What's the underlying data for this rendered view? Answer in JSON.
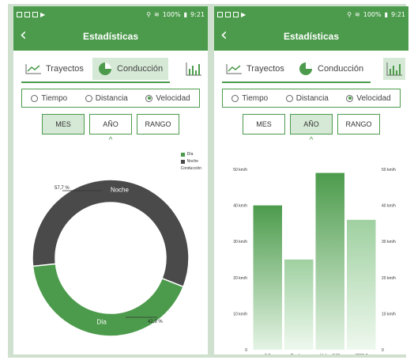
{
  "status": {
    "time": "9:21",
    "battery": "100%"
  },
  "left": {
    "title": "Estadísticas",
    "tabs": {
      "trayectos": "Trayectos",
      "conduccion": "Conducción"
    },
    "radios": [
      {
        "label": "Tiempo",
        "selected": false
      },
      {
        "label": "Distancia",
        "selected": false
      },
      {
        "label": "Velocidad",
        "selected": true
      }
    ],
    "ranges": [
      {
        "label": "MES",
        "active": true
      },
      {
        "label": "AÑO",
        "active": false
      },
      {
        "label": "RANGO",
        "active": false
      }
    ],
    "legend": {
      "dia": "Día",
      "noche": "Noche",
      "caption": "Conducción"
    },
    "chart_data": {
      "type": "pie",
      "donut": true,
      "slices": [
        {
          "label": "Noche",
          "value": 57.7,
          "value_label": "57,7 %",
          "color": "#4a4a4a"
        },
        {
          "label": "Día",
          "value": 42.3,
          "value_label": "42,3 %",
          "color": "#4c9b4c"
        }
      ]
    }
  },
  "right": {
    "title": "Estadísticas",
    "tabs": {
      "trayectos": "Trayectos",
      "conduccion": "Conducción"
    },
    "radios": [
      {
        "label": "Tiempo",
        "selected": false
      },
      {
        "label": "Distancia",
        "selected": false
      },
      {
        "label": "Velocidad",
        "selected": true
      }
    ],
    "ranges": [
      {
        "label": "MES",
        "active": false
      },
      {
        "label": "AÑO",
        "active": true
      },
      {
        "label": "RANGO",
        "active": false
      }
    ],
    "chart_data": {
      "type": "bar",
      "categories": [
        "3.0",
        "Berdugo",
        "Volvo S40",
        "4200.0"
      ],
      "values": [
        40,
        25,
        49,
        36
      ],
      "ylim": [
        0,
        50
      ],
      "yticks": [
        "0",
        "10 km/h",
        "20 km/h",
        "30 km/h",
        "40 km/h",
        "50 km/h"
      ],
      "colors": {
        "strong": "#4c9b4c",
        "light": "#9fd0a0"
      }
    }
  }
}
